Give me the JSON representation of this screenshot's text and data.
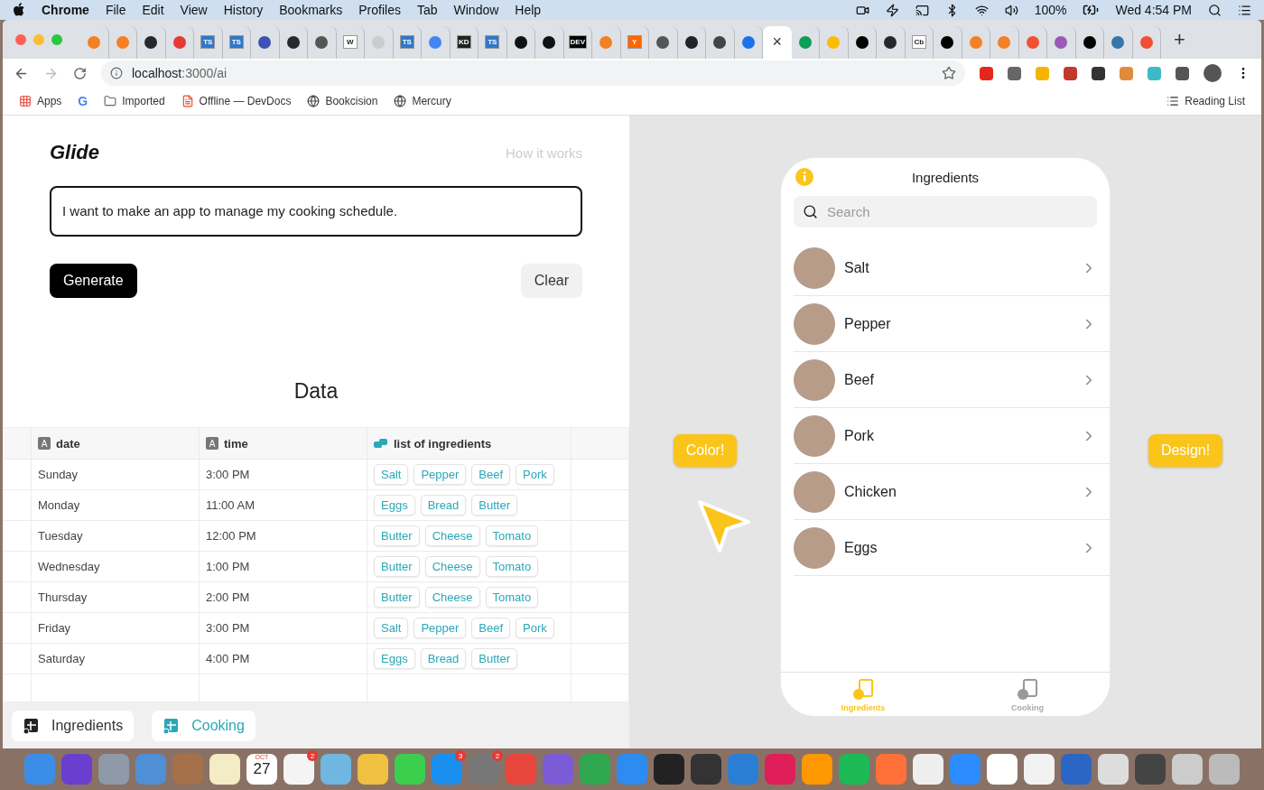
{
  "menubar": {
    "app": "Chrome",
    "menus": [
      "File",
      "Edit",
      "View",
      "History",
      "Bookmarks",
      "Profiles",
      "Tab",
      "Window",
      "Help"
    ],
    "battery": "100%",
    "clock": "Wed 4:54 PM"
  },
  "tabs": [
    {
      "kind": "dot",
      "color": "#f48024",
      "selected": false
    },
    {
      "kind": "dot",
      "color": "#f48024",
      "selected": false
    },
    {
      "kind": "dot",
      "color": "#24292e",
      "selected": false
    },
    {
      "kind": "dot",
      "color": "#e53935",
      "selected": false
    },
    {
      "kind": "text",
      "label": "TS",
      "color": "#3178c6",
      "selected": false
    },
    {
      "kind": "text",
      "label": "TS",
      "color": "#3178c6",
      "selected": false
    },
    {
      "kind": "dot",
      "color": "#3f51b5",
      "selected": false
    },
    {
      "kind": "dot",
      "color": "#24292e",
      "selected": false
    },
    {
      "kind": "dot",
      "color": "#555555",
      "selected": false
    },
    {
      "kind": "text",
      "label": "W",
      "color": "#ffffff",
      "selected": false
    },
    {
      "kind": "dot",
      "color": "#cccccc",
      "selected": false
    },
    {
      "kind": "text",
      "label": "TS",
      "color": "#3178c6",
      "selected": false
    },
    {
      "kind": "dot",
      "color": "#4285f4",
      "selected": false
    },
    {
      "kind": "text",
      "label": "KD",
      "color": "#222222",
      "selected": false
    },
    {
      "kind": "text",
      "label": "TS",
      "color": "#3178c6",
      "selected": false
    },
    {
      "kind": "dot",
      "color": "#111111",
      "selected": false
    },
    {
      "kind": "dot",
      "color": "#111111",
      "selected": false
    },
    {
      "kind": "text",
      "label": "DEV",
      "color": "#000000",
      "selected": false
    },
    {
      "kind": "dot",
      "color": "#f48024",
      "selected": false
    },
    {
      "kind": "text",
      "label": "Y",
      "color": "#ff6600",
      "selected": false
    },
    {
      "kind": "dot",
      "color": "#555555",
      "selected": false
    },
    {
      "kind": "dot",
      "color": "#20232a",
      "selected": false
    },
    {
      "kind": "dot",
      "color": "#444444",
      "selected": false
    },
    {
      "kind": "dot",
      "color": "#1a73e8",
      "selected": false
    },
    {
      "kind": "close",
      "label": "×",
      "selected": true
    },
    {
      "kind": "dot",
      "color": "#0f9d58",
      "selected": false
    },
    {
      "kind": "dot",
      "color": "#fbbc04",
      "selected": false
    },
    {
      "kind": "dot",
      "color": "#000000",
      "selected": false
    },
    {
      "kind": "dot",
      "color": "#24292e",
      "selected": false
    },
    {
      "kind": "text",
      "label": "Cb",
      "color": "#ffffff",
      "selected": false
    },
    {
      "kind": "dot",
      "color": "#000000",
      "selected": false
    },
    {
      "kind": "dot",
      "color": "#f48024",
      "selected": false
    },
    {
      "kind": "dot",
      "color": "#f48024",
      "selected": false
    },
    {
      "kind": "dot",
      "color": "#f05033",
      "selected": false
    },
    {
      "kind": "dot",
      "color": "#9b59b6",
      "selected": false
    },
    {
      "kind": "dot",
      "color": "#000000",
      "selected": false
    },
    {
      "kind": "dot",
      "color": "#3776ab",
      "selected": false
    },
    {
      "kind": "dot",
      "color": "#f05033",
      "selected": false
    }
  ],
  "new_tab": "+",
  "address": {
    "host": "localhost",
    "path": ":3000/ai"
  },
  "extensions": [
    {
      "color": "#e4261c"
    },
    {
      "color": "#666666"
    },
    {
      "color": "#f4b400"
    },
    {
      "color": "#c0392b"
    },
    {
      "color": "#333333"
    },
    {
      "color": "#e08a3c"
    },
    {
      "color": "#3fb8c9"
    },
    {
      "color": "#555555"
    }
  ],
  "bookmarks": [
    {
      "kind": "apps",
      "label": "Apps"
    },
    {
      "kind": "google",
      "label": "G"
    },
    {
      "kind": "folder",
      "label": "Imported"
    },
    {
      "kind": "page",
      "label": "Offline — DevDocs"
    },
    {
      "kind": "globe",
      "label": "Bookcision"
    },
    {
      "kind": "globe",
      "label": "Mercury"
    }
  ],
  "reading_list": "Reading List",
  "app": {
    "logo": "Glide",
    "how_it_works": "How it works",
    "prompt": "I want to make an app to manage my cooking schedule.",
    "generate": "Generate",
    "clear": "Clear",
    "data_title": "Data"
  },
  "table": {
    "columns": [
      {
        "kind": "text",
        "label": "date",
        "badge": "A"
      },
      {
        "kind": "text",
        "label": "time",
        "badge": "A"
      },
      {
        "kind": "relation",
        "label": "list of ingredients"
      }
    ],
    "rows": [
      {
        "date": "Sunday",
        "time": "3:00 PM",
        "ingredients": [
          "Salt",
          "Pepper",
          "Beef",
          "Pork"
        ]
      },
      {
        "date": "Monday",
        "time": "11:00 AM",
        "ingredients": [
          "Eggs",
          "Bread",
          "Butter"
        ]
      },
      {
        "date": "Tuesday",
        "time": "12:00 PM",
        "ingredients": [
          "Butter",
          "Cheese",
          "Tomato"
        ]
      },
      {
        "date": "Wednesday",
        "time": "1:00 PM",
        "ingredients": [
          "Butter",
          "Cheese",
          "Tomato"
        ]
      },
      {
        "date": "Thursday",
        "time": "2:00 PM",
        "ingredients": [
          "Butter",
          "Cheese",
          "Tomato"
        ]
      },
      {
        "date": "Friday",
        "time": "3:00 PM",
        "ingredients": [
          "Salt",
          "Pepper",
          "Beef",
          "Pork"
        ]
      },
      {
        "date": "Saturday",
        "time": "4:00 PM",
        "ingredients": [
          "Eggs",
          "Bread",
          "Butter"
        ]
      }
    ]
  },
  "sheet_tabs": [
    {
      "label": "Ingredients",
      "selected": false
    },
    {
      "label": "Cooking",
      "selected": true
    }
  ],
  "canvas": {
    "left_bubble": "Color!",
    "right_bubble": "Design!"
  },
  "phone": {
    "title": "Ingredients",
    "search_placeholder": "Search",
    "items": [
      "Salt",
      "Pepper",
      "Beef",
      "Pork",
      "Chicken",
      "Eggs"
    ],
    "nav": [
      {
        "label": "Ingredients",
        "selected": true
      },
      {
        "label": "Cooking",
        "selected": false
      }
    ]
  },
  "dock": [
    {
      "color": "#3b8ee8"
    },
    {
      "color": "#6a3fd0"
    },
    {
      "color": "#8e9aa8"
    },
    {
      "color": "#4f8fd6"
    },
    {
      "color": "#a5714a"
    },
    {
      "color": "#f3ecc4"
    },
    {
      "kind": "calendar",
      "month": "OCT",
      "day": "27"
    },
    {
      "color": "#f4f4f4",
      "badge": "2"
    },
    {
      "color": "#6fb7e0"
    },
    {
      "color": "#f0c040"
    },
    {
      "color": "#3ccf4e"
    },
    {
      "color": "#1b8ff0",
      "badge": "3"
    },
    {
      "color": "#777777",
      "badge": "2"
    },
    {
      "color": "#e8453c"
    },
    {
      "color": "#7b5cd6"
    },
    {
      "color": "#2fa84f"
    },
    {
      "color": "#2d8cf0"
    },
    {
      "color": "#222222"
    },
    {
      "color": "#333333"
    },
    {
      "color": "#2a7fd4"
    },
    {
      "color": "#e01e5a"
    },
    {
      "color": "#ff9800"
    },
    {
      "color": "#1db954"
    },
    {
      "color": "#ff7139"
    },
    {
      "color": "#eeeeee"
    },
    {
      "color": "#2d8cff"
    },
    {
      "color": "#ffffff"
    },
    {
      "color": "#f2f2f2"
    },
    {
      "color": "#2b66c4"
    },
    {
      "color": "#dddddd"
    },
    {
      "color": "#444444"
    },
    {
      "color": "#cccccc"
    },
    {
      "color": "#bbbbbb"
    }
  ]
}
